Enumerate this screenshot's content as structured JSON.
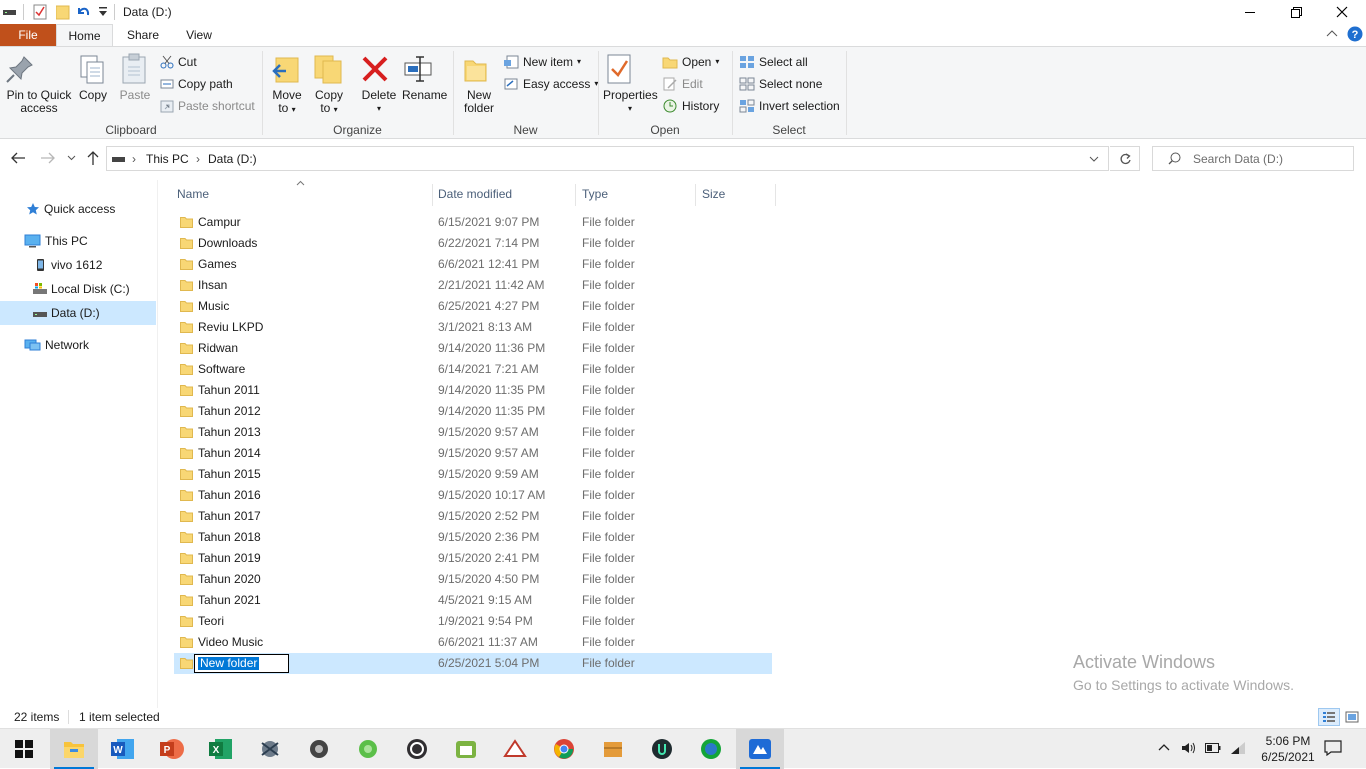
{
  "window": {
    "title": "Data (D:)"
  },
  "ribbon_tabs": {
    "file": "File",
    "home": "Home",
    "share": "Share",
    "view": "View"
  },
  "clipboard": {
    "group_label": "Clipboard",
    "pin_line1": "Pin to Quick",
    "pin_line2": "access",
    "copy": "Copy",
    "paste": "Paste",
    "cut": "Cut",
    "copy_path": "Copy path",
    "paste_shortcut": "Paste shortcut"
  },
  "organize": {
    "group_label": "Organize",
    "move_line1": "Move",
    "move_line2": "to",
    "copy_line1": "Copy",
    "copy_line2": "to",
    "delete": "Delete",
    "rename": "Rename"
  },
  "new": {
    "group_label": "New",
    "new_folder_line1": "New",
    "new_folder_line2": "folder",
    "new_item": "New item",
    "easy_access": "Easy access"
  },
  "open": {
    "group_label": "Open",
    "properties": "Properties",
    "open": "Open",
    "edit": "Edit",
    "history": "History"
  },
  "select": {
    "group_label": "Select",
    "select_all": "Select all",
    "select_none": "Select none",
    "invert": "Invert selection"
  },
  "address": {
    "crumb1": "This PC",
    "crumb2": "Data (D:)"
  },
  "search": {
    "placeholder": "Search Data (D:)"
  },
  "nav": {
    "quick_access": "Quick access",
    "this_pc": "This PC",
    "vivo": "vivo 1612",
    "local_disk": "Local Disk (C:)",
    "data": "Data (D:)",
    "network": "Network"
  },
  "columns": {
    "name": "Name",
    "date": "Date modified",
    "type": "Type",
    "size": "Size"
  },
  "files": [
    {
      "name": "Campur",
      "date": "6/15/2021 9:07 PM",
      "type": "File folder"
    },
    {
      "name": "Downloads",
      "date": "6/22/2021 7:14 PM",
      "type": "File folder"
    },
    {
      "name": "Games",
      "date": "6/6/2021 12:41 PM",
      "type": "File folder"
    },
    {
      "name": "Ihsan",
      "date": "2/21/2021 11:42 AM",
      "type": "File folder"
    },
    {
      "name": "Music",
      "date": "6/25/2021 4:27 PM",
      "type": "File folder"
    },
    {
      "name": "Reviu LKPD",
      "date": "3/1/2021 8:13 AM",
      "type": "File folder"
    },
    {
      "name": "Ridwan",
      "date": "9/14/2020 11:36 PM",
      "type": "File folder"
    },
    {
      "name": "Software",
      "date": "6/14/2021 7:21 AM",
      "type": "File folder"
    },
    {
      "name": "Tahun 2011",
      "date": "9/14/2020 11:35 PM",
      "type": "File folder"
    },
    {
      "name": "Tahun 2012",
      "date": "9/14/2020 11:35 PM",
      "type": "File folder"
    },
    {
      "name": "Tahun 2013",
      "date": "9/15/2020 9:57 AM",
      "type": "File folder"
    },
    {
      "name": "Tahun 2014",
      "date": "9/15/2020 9:57 AM",
      "type": "File folder"
    },
    {
      "name": "Tahun 2015",
      "date": "9/15/2020 9:59 AM",
      "type": "File folder"
    },
    {
      "name": "Tahun 2016",
      "date": "9/15/2020 10:17 AM",
      "type": "File folder"
    },
    {
      "name": "Tahun 2017",
      "date": "9/15/2020 2:52 PM",
      "type": "File folder"
    },
    {
      "name": "Tahun 2018",
      "date": "9/15/2020 2:36 PM",
      "type": "File folder"
    },
    {
      "name": "Tahun 2019",
      "date": "9/15/2020 2:41 PM",
      "type": "File folder"
    },
    {
      "name": "Tahun 2020",
      "date": "9/15/2020 4:50 PM",
      "type": "File folder"
    },
    {
      "name": "Tahun 2021",
      "date": "4/5/2021 9:15 AM",
      "type": "File folder"
    },
    {
      "name": "Teori",
      "date": "1/9/2021 9:54 PM",
      "type": "File folder"
    },
    {
      "name": "Video Music",
      "date": "6/6/2021 11:37 AM",
      "type": "File folder"
    },
    {
      "name": "New folder",
      "date": "6/25/2021 5:04 PM",
      "type": "File folder",
      "selected": true,
      "renaming": true
    }
  ],
  "status": {
    "count": "22 items",
    "selected": "1 item selected"
  },
  "watermark": {
    "line1": "Activate Windows",
    "line2": "Go to Settings to activate Windows."
  },
  "clock": {
    "time": "5:06 PM",
    "date": "6/25/2021"
  },
  "colors": {
    "accent": "#0078d7",
    "file_tab": "#c0501b",
    "selection": "#cce8ff",
    "folder": "#f8d775"
  },
  "taskbar_apps": [
    "start-icon",
    "file-explorer-icon",
    "word-icon",
    "powerpoint-icon",
    "excel-icon",
    "app-icon",
    "app-icon",
    "app-icon",
    "obs-icon",
    "android-icon",
    "app-icon",
    "chrome-icon",
    "app-icon",
    "app-icon",
    "app-icon",
    "app-icon"
  ]
}
